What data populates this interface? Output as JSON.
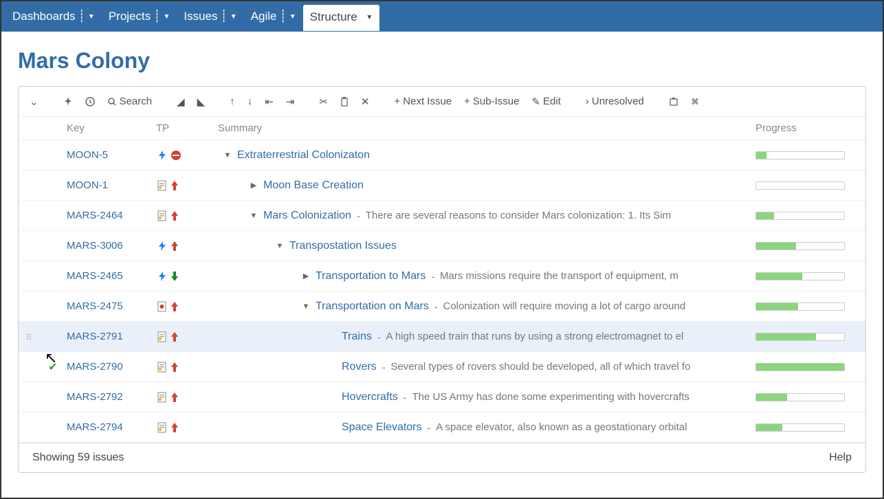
{
  "nav": {
    "items": [
      {
        "label": "Dashboards"
      },
      {
        "label": "Projects"
      },
      {
        "label": "Issues"
      },
      {
        "label": "Agile"
      },
      {
        "label": "Structure",
        "active": true
      }
    ]
  },
  "page": {
    "title": "Mars Colony"
  },
  "toolbar": {
    "search": "Search",
    "next_issue": "Next Issue",
    "sub_issue": "Sub-Issue",
    "edit": "Edit",
    "unresolved": "Unresolved"
  },
  "columns": {
    "key": "Key",
    "tp": "TP",
    "summary": "Summary",
    "progress": "Progress"
  },
  "rows": [
    {
      "key": "MOON-5",
      "type": "bolt",
      "priority": "blocker",
      "indent": 0,
      "arrow": "down",
      "title": "Extraterrestrial Colonizaton",
      "desc": "",
      "progress": 12
    },
    {
      "key": "MOON-1",
      "type": "doc",
      "priority": "up-red",
      "indent": 1,
      "arrow": "right",
      "title": "Moon Base Creation",
      "desc": "",
      "progress": 0
    },
    {
      "key": "MARS-2464",
      "type": "doc",
      "priority": "up-red",
      "indent": 1,
      "arrow": "down",
      "title": "Mars Colonization",
      "desc": "There are several reasons to consider Mars colonization: 1. Its Sim",
      "progress": 20
    },
    {
      "key": "MARS-3006",
      "type": "bolt",
      "priority": "up-red",
      "indent": 2,
      "arrow": "down",
      "title": "Transpostation Issues",
      "desc": "",
      "progress": 45
    },
    {
      "key": "MARS-2465",
      "type": "bolt",
      "priority": "down-green",
      "indent": 3,
      "arrow": "right",
      "title": "Transportation to Mars",
      "desc": "Mars missions require the transport of equipment, m",
      "progress": 52
    },
    {
      "key": "MARS-2475",
      "type": "dot",
      "priority": "up-red",
      "indent": 3,
      "arrow": "down",
      "title": "Transportation on Mars",
      "desc": "Colonization will require moving a lot of cargo around",
      "progress": 48
    },
    {
      "key": "MARS-2791",
      "type": "doc",
      "priority": "up-red",
      "indent": 4,
      "arrow": "",
      "title": "Trains",
      "desc": "A high speed train that runs by using a strong electromagnet to el",
      "progress": 68,
      "highlight": true,
      "handle": true
    },
    {
      "key": "MARS-2790",
      "type": "doc",
      "priority": "up-red",
      "indent": 4,
      "arrow": "",
      "title": "Rovers",
      "desc": "Several types of rovers should be developed, all of which travel fo",
      "progress": 100,
      "check": true
    },
    {
      "key": "MARS-2792",
      "type": "doc",
      "priority": "up-red",
      "indent": 4,
      "arrow": "",
      "title": "Hovercrafts",
      "desc": "The US Army has done some experimenting with hovercrafts",
      "progress": 35
    },
    {
      "key": "MARS-2794",
      "type": "doc",
      "priority": "up-red",
      "indent": 4,
      "arrow": "",
      "title": "Space Elevators",
      "desc": "A space elevator, also known as a geostationary orbital",
      "progress": 30
    }
  ],
  "footer": {
    "showing": "Showing 59 issues",
    "help": "Help"
  }
}
